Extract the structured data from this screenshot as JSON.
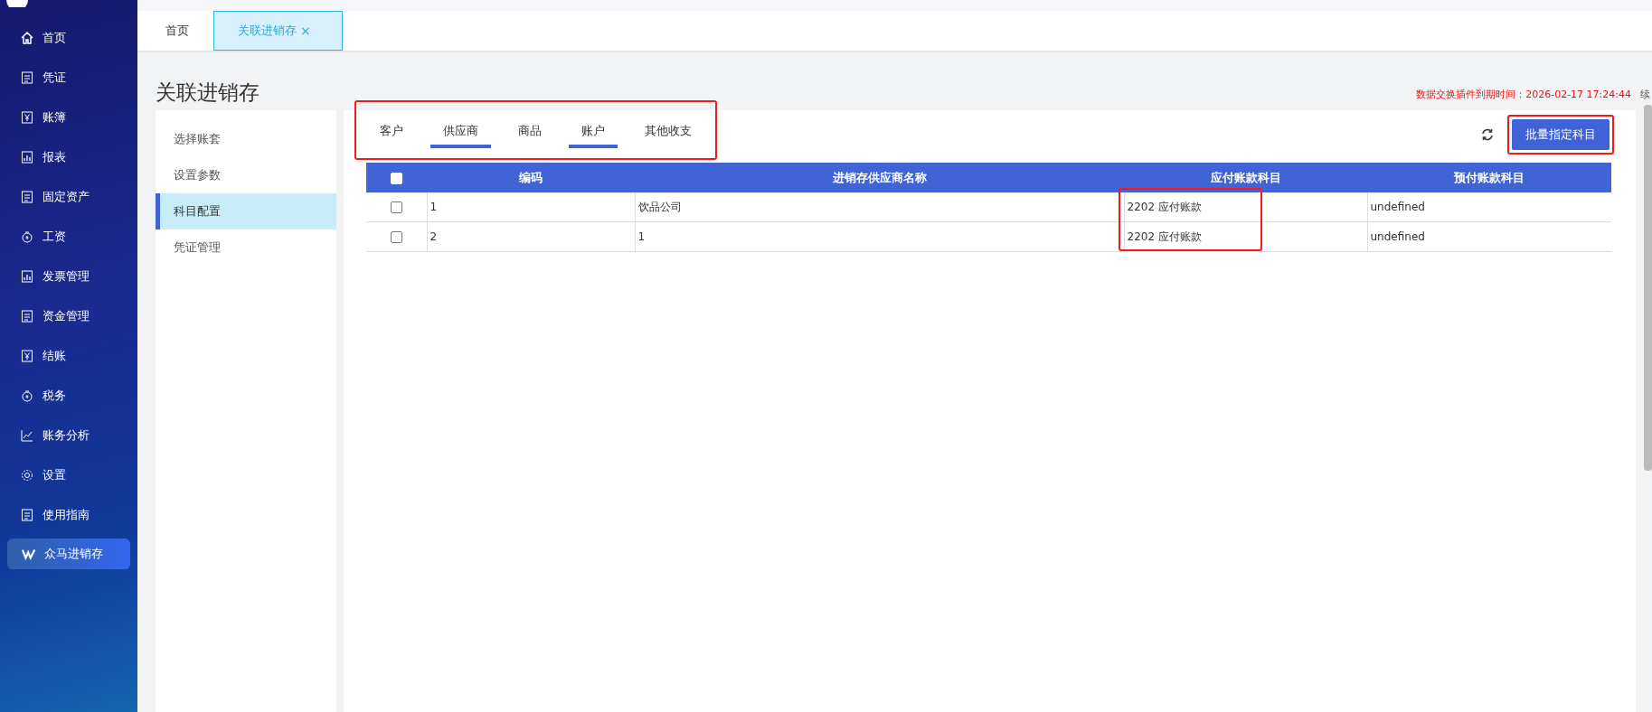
{
  "sidebar": {
    "items": [
      {
        "label": "首页",
        "selected": false
      },
      {
        "label": "凭证",
        "selected": false
      },
      {
        "label": "账簿",
        "selected": false
      },
      {
        "label": "报表",
        "selected": false
      },
      {
        "label": "固定资产",
        "selected": false
      },
      {
        "label": "工资",
        "selected": false
      },
      {
        "label": "发票管理",
        "selected": false
      },
      {
        "label": "资金管理",
        "selected": false
      },
      {
        "label": "结账",
        "selected": false
      },
      {
        "label": "税务",
        "selected": false
      },
      {
        "label": "账务分析",
        "selected": false
      },
      {
        "label": "设置",
        "selected": false
      },
      {
        "label": "使用指南",
        "selected": false
      },
      {
        "label": "众马进销存",
        "selected": true
      }
    ]
  },
  "page_tabs": [
    {
      "label": "首页",
      "selected": false
    },
    {
      "label": "关联进销存",
      "selected": true,
      "close": "×"
    }
  ],
  "page_title": "关联进销存",
  "expiry_notice": "数据交换插件到期时间：2026-02-17 17:24:44",
  "renew_link": "续",
  "steps": [
    {
      "label": "选择账套",
      "selected": false
    },
    {
      "label": "设置参数",
      "selected": false
    },
    {
      "label": "科目配置",
      "selected": true
    },
    {
      "label": "凭证管理",
      "selected": false
    }
  ],
  "tabs": {
    "highlighted": true,
    "items": [
      {
        "label": "客户",
        "selected": false
      },
      {
        "label": "供应商",
        "selected": true
      },
      {
        "label": "商品",
        "selected": false
      },
      {
        "label": "账户",
        "selected": true
      },
      {
        "label": "其他收支",
        "selected": false
      }
    ]
  },
  "batch_button": {
    "label": "批量指定科目",
    "highlighted": true
  },
  "table": {
    "header_checked": false,
    "columns": [
      {
        "label": "编码",
        "highlighted": false
      },
      {
        "label": "进销存供应商名称",
        "highlighted": false
      },
      {
        "label": "应付账款科目",
        "highlighted": true
      },
      {
        "label": "预付账款科目",
        "highlighted": false
      }
    ],
    "rows": [
      {
        "checked": false,
        "cells": [
          "1",
          "饮品公司",
          "2202 应付账款",
          "undefined"
        ]
      },
      {
        "checked": false,
        "cells": [
          "2",
          "1",
          "2202 应付账款",
          "undefined"
        ]
      }
    ]
  }
}
